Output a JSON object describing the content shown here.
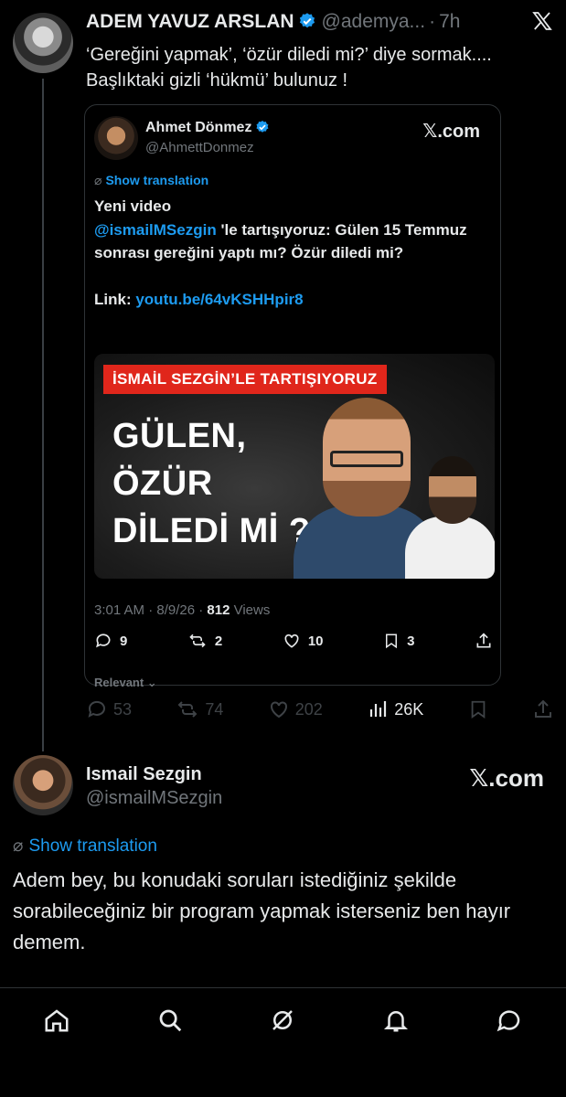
{
  "main_tweet": {
    "author_name": "ADEM YAVUZ ARSLAN",
    "handle": "@ademya...",
    "separator": "·",
    "time": "7h",
    "text": "‘Gereğini yapmak’, ‘özür diledi mi?’ diye sormak.... Başlıktaki gizli ‘hükmü’ bulunuz !",
    "stats": {
      "replies": "53",
      "reposts": "74",
      "likes": "202",
      "views": "26K"
    }
  },
  "quoted_tweet": {
    "author_name": "Ahmet Dönmez",
    "handle": "@AhmettDonmez",
    "source": "𝕏.com",
    "show_translation": "Show translation",
    "text_line1": "Yeni video",
    "mention": "@ismailMSezgin",
    "text_after_mention": " 'le tartışıyoruz: Gülen 15 Temmuz sonrası gereğini yaptı mı? Özür diledi mi?",
    "link_label": "Link: ",
    "link_url": "youtu.be/64vKSHHpir8",
    "thumbnail": {
      "banner": "İSMAİL SEZGİN’LE TARTIŞIYORUZ",
      "headline": "GÜLEN, ÖZÜR DİLEDİ Mİ ?"
    },
    "time": "3:01 AM · 8/9/26 · ",
    "views_count": "812",
    "views_label": " Views",
    "stats": {
      "replies": "9",
      "reposts": "2",
      "likes": "10",
      "bookmarks": "3"
    },
    "relevant": "Relevant ⌄"
  },
  "reply": {
    "author_name": "Ismail Sezgin",
    "handle": "@ismailMSezgin",
    "source": "𝕏.com",
    "show_translation": "Show translation",
    "text": "Adem bey, bu konudaki soruları istediğiniz şekilde sorabileceğiniz bir program yapmak isterseniz ben hayır demem."
  },
  "icons": {
    "top_right": "x-logo-icon",
    "translate": "translate-icon",
    "nav": [
      "home-icon",
      "search-icon",
      "grok-icon",
      "notifications-icon",
      "messages-icon"
    ]
  },
  "colors": {
    "background": "#000000",
    "accent": "#1d9bf0",
    "muted": "#71767b",
    "text": "#e7e9ea"
  }
}
